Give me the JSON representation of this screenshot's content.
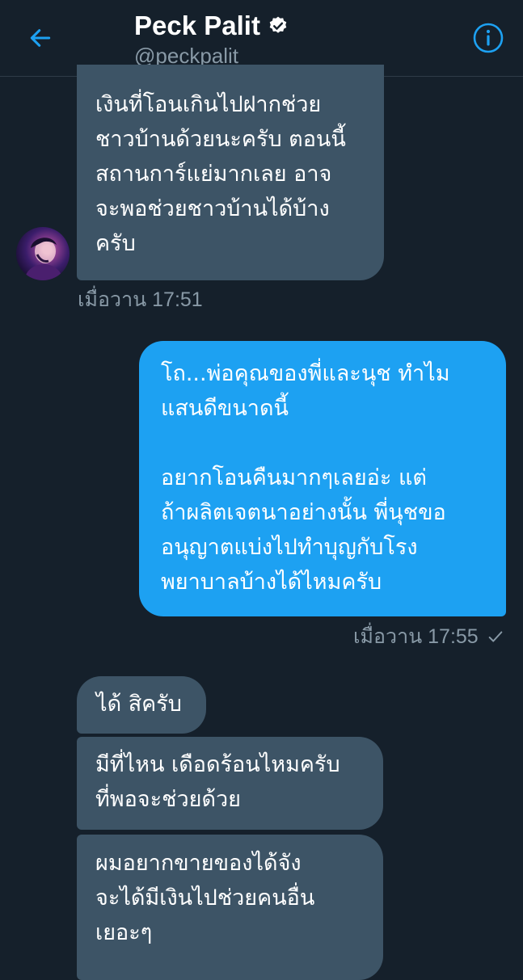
{
  "header": {
    "title": "Peck Palit",
    "handle": "@peckpalit",
    "verified": true,
    "back_icon": "arrow-left-icon",
    "info_icon": "info-circle-icon"
  },
  "colors": {
    "background": "#15202b",
    "incoming_bubble": "#3d5466",
    "outgoing_bubble": "#1da1f2",
    "accent": "#1da1f2",
    "muted_text": "#8899a6"
  },
  "messages": [
    {
      "direction": "incoming",
      "text": "เงินที่โอนเกินไปฝากช่วย\nชาวบ้านด้วยนะครับ ตอนนี้\nสถานการ์แย่มากเลย อาจ\nจะพอช่วยชาวบ้านได้บ้าง\nครับ",
      "timestamp": "เมื่อวาน 17:51"
    },
    {
      "direction": "outgoing",
      "text": "โถ...พ่อคุณของพี่และนุช ทำไม\nแสนดีขนาดนี้\n\nอยากโอนคืนมากๆเลยอ่ะ แต่\nถ้าผลิตเจตนาอย่างนั้น พี่นุชขอ\nอนุญาตแบ่งไปทำบุญกับโรง\nพยาบาลบ้างได้ไหมครับ",
      "timestamp": "เมื่อวาน 17:55",
      "status_icon": "checkmark-icon"
    },
    {
      "direction": "incoming",
      "text": "ได้ สิครับ"
    },
    {
      "direction": "incoming",
      "text": "มีที่ไหน เดือดร้อนไหมครับ\nที่พอจะช่วยด้วย"
    },
    {
      "direction": "incoming",
      "text": "ผมอยากขายของได้จัง\nจะได้มีเงินไปช่วยคนอื่น\nเยอะๆ"
    }
  ]
}
